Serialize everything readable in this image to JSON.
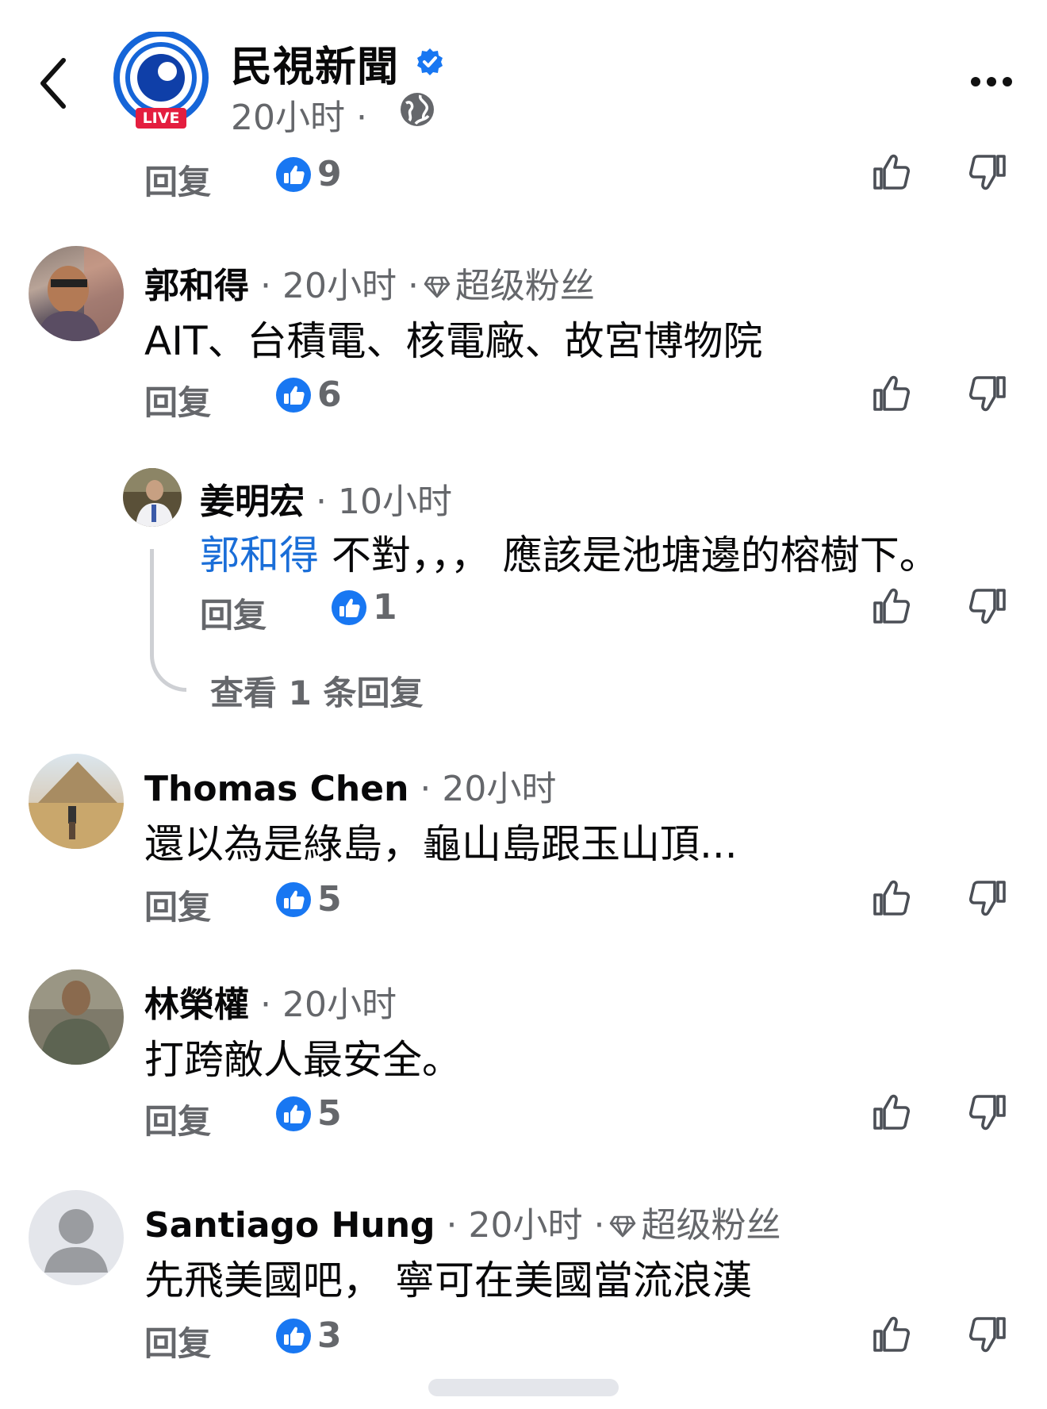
{
  "header": {
    "page_name": "民視新聞",
    "post_time": "20小时 ·",
    "logo_badge": "LIVE",
    "icons": [
      "back-arrow-icon",
      "verified-badge-icon",
      "globe-icon",
      "more-options-icon"
    ]
  },
  "top_actions": {
    "reply_label": "回复",
    "likes": "9"
  },
  "comments": [
    {
      "author": "郭和得",
      "meta": "· 20小时 ·",
      "badge": "超级粉丝",
      "text": "AIT、台積電、核電廠、故宮博物院",
      "reply_label": "回复",
      "likes": "6"
    },
    {
      "author": "姜明宏",
      "meta": "· 10小时",
      "mention": "郭和得",
      "text": "不對，，，  應該是池塘邊的榕樹下。",
      "reply_label": "回复",
      "likes": "1"
    },
    {
      "author": "Thomas Chen",
      "meta": "· 20小时",
      "text": "還以為是綠島，龜山島跟玉山頂...",
      "reply_label": "回复",
      "likes": "5"
    },
    {
      "author": "林榮權",
      "meta": "· 20小时",
      "text": "打跨敵人最安全。",
      "reply_label": "回复",
      "likes": "5"
    },
    {
      "author": "Santiago Hung",
      "meta": "· 20小时 ·",
      "badge": "超级粉丝",
      "text": "先飛美國吧，  寧可在美國當流浪漢",
      "reply_label": "回复",
      "likes": "3"
    }
  ],
  "view_more_replies": "查看 1 条回复",
  "colors": {
    "accent": "#1877f2",
    "mention": "#1a6ed8",
    "secondary": "#65676b",
    "live": "#e41e3f"
  }
}
